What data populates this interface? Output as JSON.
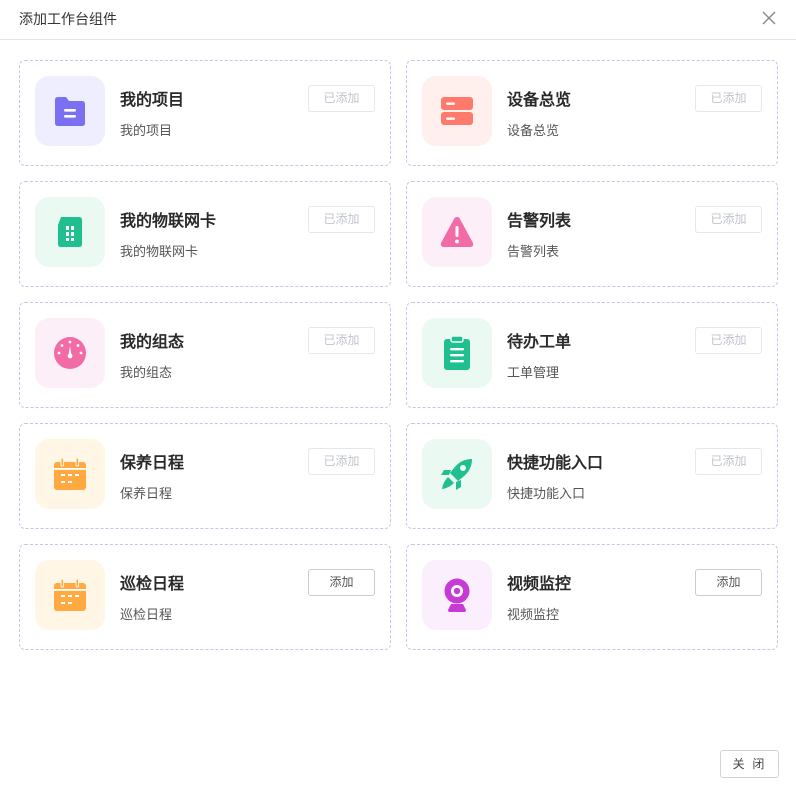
{
  "dialog": {
    "title": "添加工作台组件",
    "close_icon": "close-icon",
    "footer_close_label": "关 闭"
  },
  "widgets": [
    {
      "name": "我的项目",
      "desc": "我的项目",
      "button": "已添加",
      "added": true,
      "icon": "folder-document-icon",
      "icon_color": "#7b6ff2",
      "icon_bg": "#efeeff"
    },
    {
      "name": "设备总览",
      "desc": "设备总览",
      "button": "已添加",
      "added": true,
      "icon": "server-icon",
      "icon_color": "#ff7a6b",
      "icon_bg": "#fff0ed"
    },
    {
      "name": "我的物联网卡",
      "desc": "我的物联网卡",
      "button": "已添加",
      "added": true,
      "icon": "sim-card-icon",
      "icon_color": "#1fbf8f",
      "icon_bg": "#eafaf3"
    },
    {
      "name": "告警列表",
      "desc": "告警列表",
      "button": "已添加",
      "added": true,
      "icon": "warning-icon",
      "icon_color": "#f26aa6",
      "icon_bg": "#fdeff7"
    },
    {
      "name": "我的组态",
      "desc": "我的组态",
      "button": "已添加",
      "added": true,
      "icon": "dashboard-gauge-icon",
      "icon_color": "#f26aa6",
      "icon_bg": "#fdeff7"
    },
    {
      "name": "待办工单",
      "desc": "工单管理",
      "button": "已添加",
      "added": true,
      "icon": "clipboard-icon",
      "icon_color": "#1fbf8f",
      "icon_bg": "#eafaf3"
    },
    {
      "name": "保养日程",
      "desc": "保养日程",
      "button": "已添加",
      "added": true,
      "icon": "calendar-icon",
      "icon_color": "#ffa940",
      "icon_bg": "#fff6e6"
    },
    {
      "name": "快捷功能入口",
      "desc": "快捷功能入口",
      "button": "已添加",
      "added": true,
      "icon": "rocket-icon",
      "icon_color": "#1fbf8f",
      "icon_bg": "#eafaf3"
    },
    {
      "name": "巡检日程",
      "desc": "巡检日程",
      "button": "添加",
      "added": false,
      "icon": "calendar-icon",
      "icon_color": "#ffa940",
      "icon_bg": "#fff6e6"
    },
    {
      "name": "视频监控",
      "desc": "视频监控",
      "button": "添加",
      "added": false,
      "icon": "webcam-icon",
      "icon_color": "#c63ad6",
      "icon_bg": "#fbeefd"
    }
  ]
}
